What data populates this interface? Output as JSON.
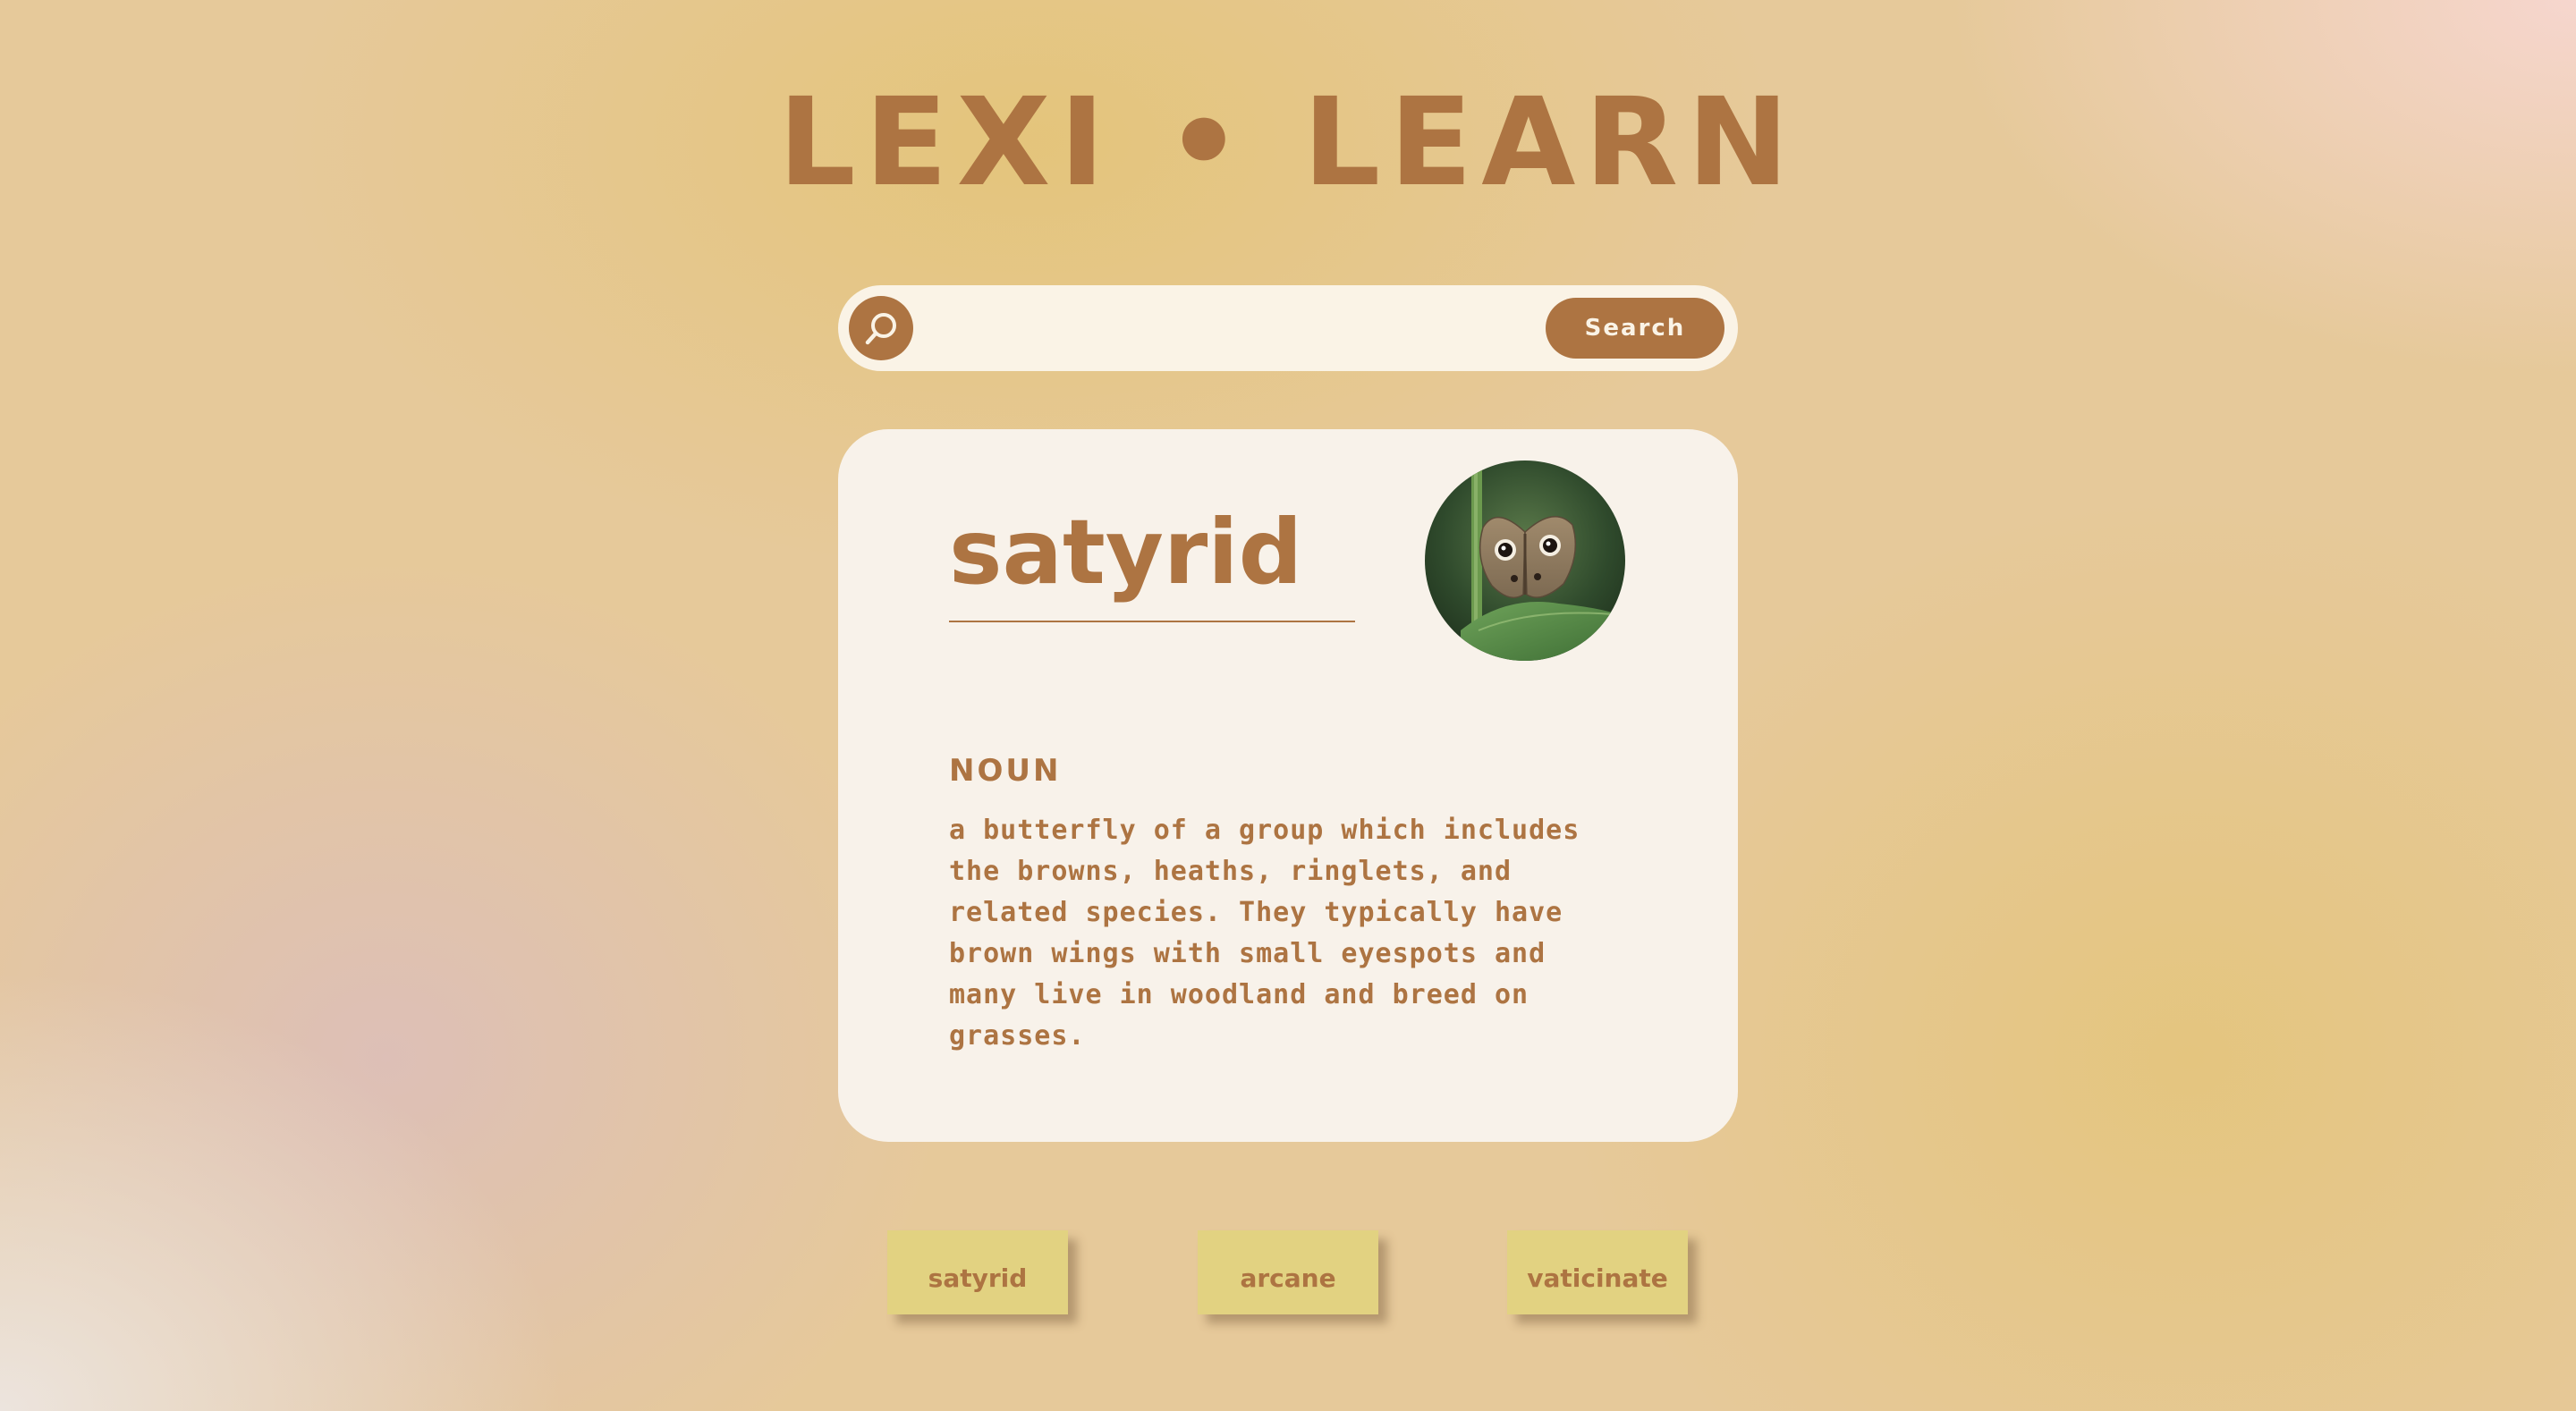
{
  "app": {
    "title": "LEXI • LEARN"
  },
  "search": {
    "value": "",
    "placeholder": "",
    "button_label": "Search",
    "icon": "search-icon"
  },
  "card": {
    "word": "satyrid",
    "image": "butterfly-photo",
    "part_of_speech": "NOUN",
    "definition": "a butterfly of a group which includes the browns, heaths, ringlets, and related species. They typically have brown wings with small eyespots and many live in woodland and breed on grasses."
  },
  "history": {
    "items": [
      {
        "label": "satyrid"
      },
      {
        "label": "arcane"
      },
      {
        "label": "vaticinate"
      }
    ]
  },
  "colors": {
    "accent": "#ad7442",
    "card_bg": "#f8f2ea",
    "search_bg": "#faf3e6",
    "chip_bg": "#e2d281"
  }
}
